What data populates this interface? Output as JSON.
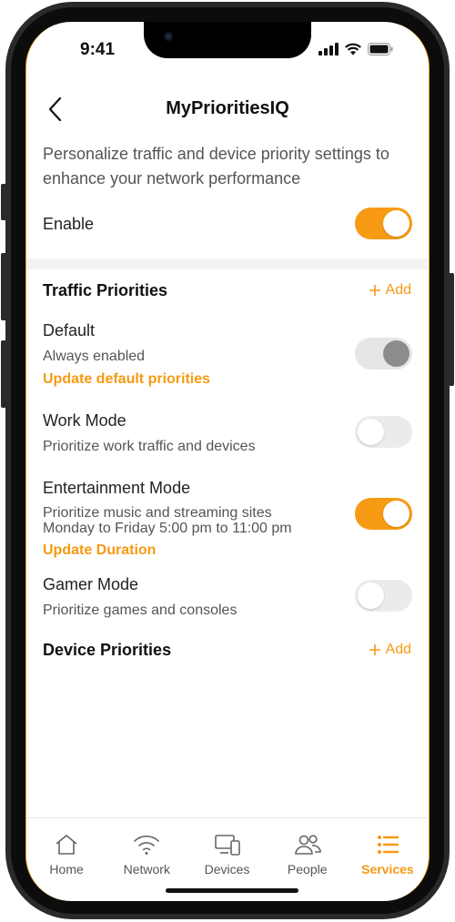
{
  "status": {
    "time": "9:41"
  },
  "header": {
    "title": "MyPrioritiesIQ"
  },
  "description": "Personalize traffic and device priority settings to enhance your network performance",
  "enable": {
    "label": "Enable",
    "on": true
  },
  "traffic": {
    "title": "Traffic Priorities",
    "add_label": "Add",
    "items": [
      {
        "label": "Default",
        "sub": "Always enabled",
        "link": "Update default priorities",
        "state": "disabled-on"
      },
      {
        "label": "Work Mode",
        "sub": "Prioritize work traffic and devices",
        "state": "off"
      },
      {
        "label": "Entertainment Mode",
        "sub": "Prioritize music and streaming sites",
        "sub2": "Monday to Friday 5:00 pm to 11:00 pm",
        "link": "Update Duration",
        "state": "on"
      },
      {
        "label": "Gamer Mode",
        "sub": "Prioritize games and consoles",
        "state": "off"
      }
    ]
  },
  "device": {
    "title": "Device Priorities",
    "add_label": "Add"
  },
  "tabs": [
    {
      "label": "Home",
      "icon": "home-icon",
      "active": false
    },
    {
      "label": "Network",
      "icon": "wifi-icon",
      "active": false
    },
    {
      "label": "Devices",
      "icon": "devices-icon",
      "active": false
    },
    {
      "label": "People",
      "icon": "people-icon",
      "active": false
    },
    {
      "label": "Services",
      "icon": "list-icon",
      "active": true
    }
  ],
  "colors": {
    "accent": "#f79a14",
    "text": "#222222",
    "muted": "#555555"
  }
}
